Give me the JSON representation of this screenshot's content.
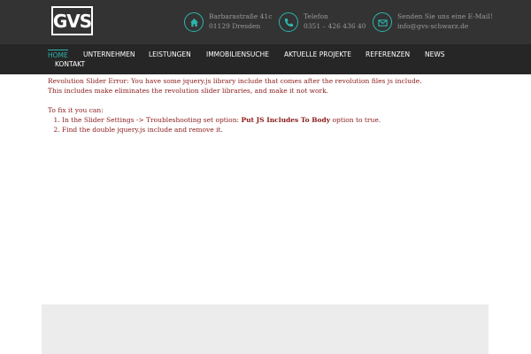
{
  "header": {
    "logo_text": "GVS",
    "address": {
      "icon": "home-icon",
      "line1": "Barbarastraße 41c",
      "line2": "01129 Dresden"
    },
    "phone": {
      "icon": "phone-icon",
      "line1": "Telefon",
      "line2": "0351 – 426 436 40"
    },
    "email": {
      "icon": "envelope-icon",
      "line1": "Senden Sie uns eine E-Mail!",
      "line2": "info@gvs-schwarz.de"
    }
  },
  "nav": {
    "items": [
      {
        "label": "HOME",
        "active": true
      },
      {
        "label": "UNTERNEHMEN"
      },
      {
        "label": "LEISTUNGEN"
      },
      {
        "label": "IMMOBILIENSUCHE"
      },
      {
        "label": "AKTUELLE PROJEKTE"
      },
      {
        "label": "REFERENZEN"
      },
      {
        "label": "NEWS"
      },
      {
        "label": "KONTAKT"
      }
    ]
  },
  "error": {
    "line1": "Revolution Slider Error: You have some jquery.js library include that comes after the revolution files js include.",
    "line2": "This includes make eliminates the revolution slider libraries, and make it not work.",
    "fix_intro": "To fix it you can:",
    "step1_prefix": "In the Slider Settings -> Troubleshooting set option:",
    "step1_bold": "Put JS Includes To Body",
    "step1_suffix": "option to true.",
    "step2": "Find the double jquery.js include and remove it."
  },
  "colors": {
    "accent": "#2bb5ad",
    "error_text": "#8b1a1a",
    "topbar": "#333333",
    "navbar": "#262626"
  }
}
